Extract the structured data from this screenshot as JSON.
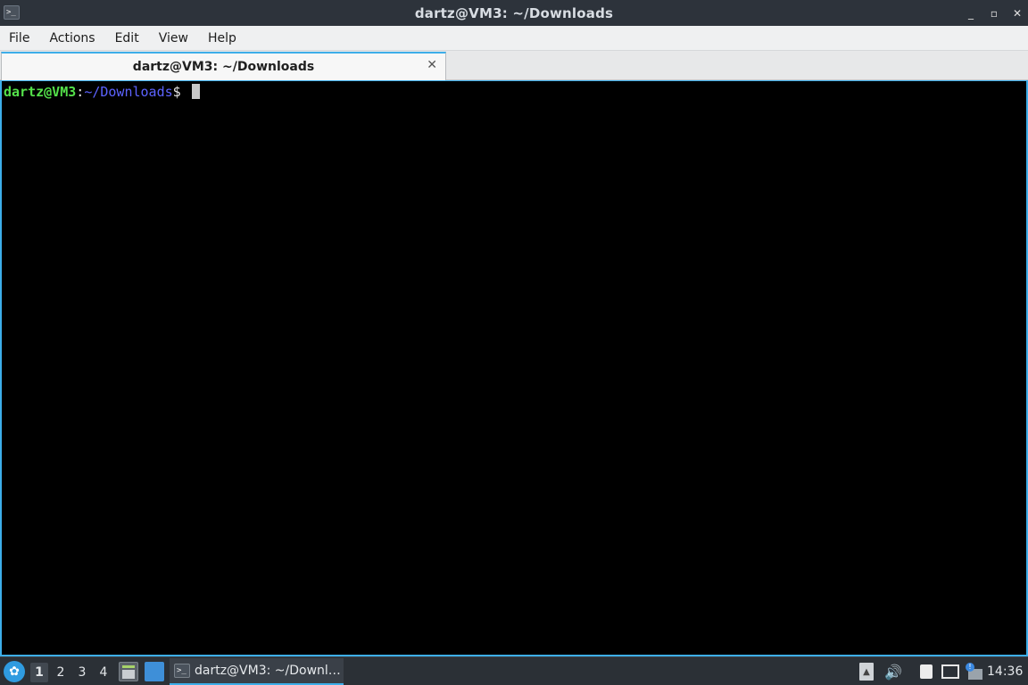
{
  "window": {
    "title": "dartz@VM3: ~/Downloads",
    "icon": "terminal-icon",
    "controls": {
      "minimize": "_",
      "maximize": "▫",
      "close": "✕"
    }
  },
  "menubar": {
    "items": [
      "File",
      "Actions",
      "Edit",
      "View",
      "Help"
    ]
  },
  "tabs": [
    {
      "label": "dartz@VM3: ~/Downloads",
      "close": "✕"
    }
  ],
  "terminal": {
    "prompt_user_host": "dartz@VM3",
    "prompt_colon": ":",
    "prompt_path": "~/Downloads",
    "prompt_symbol": "$",
    "colors": {
      "user": "#54e04a",
      "path": "#5c63ff",
      "background": "#000000",
      "border": "#3daee9"
    }
  },
  "taskbar": {
    "start_icon": "lxqt-start-icon",
    "desktops": [
      "1",
      "2",
      "3",
      "4"
    ],
    "active_desktop": "1",
    "quicklaunch": [
      "file-manager-icon",
      "show-desktop-icon"
    ],
    "tasks": [
      {
        "label": "dartz@VM3: ~/Downl…",
        "icon": "terminal-icon"
      }
    ],
    "tray": {
      "arrow": "▲",
      "volume": "🔊",
      "icons": [
        "clipboard-icon",
        "network-icon",
        "update-notifier-icon"
      ],
      "update_badge": "!"
    },
    "clock": "14:36"
  }
}
